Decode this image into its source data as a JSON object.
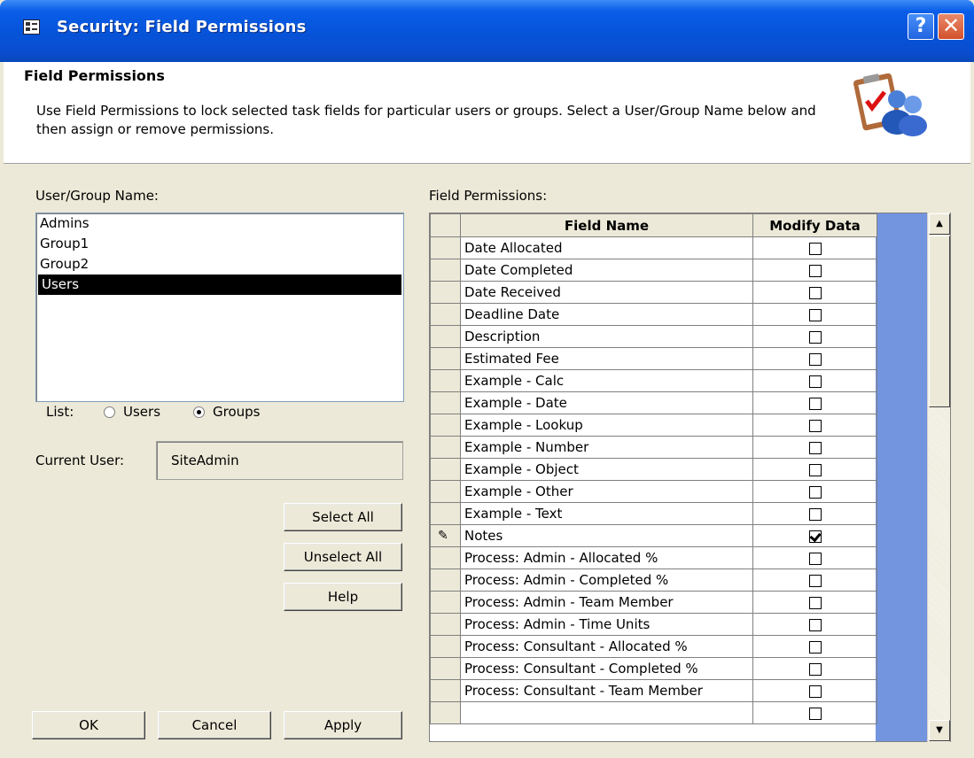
{
  "window": {
    "title": "Security: Field Permissions",
    "help_glyph": "?",
    "close_glyph": "✕"
  },
  "header": {
    "title": "Field Permissions",
    "description": "Use Field Permissions to lock selected task fields for particular users or groups. Select a User/Group Name below and then assign or remove permissions.",
    "icon": "clipboard-users-icon"
  },
  "left": {
    "user_group_label": "User/Group Name:",
    "items": [
      "Admins",
      "Group1",
      "Group2",
      "Users"
    ],
    "selected": "Users",
    "list_label": "List:",
    "radio_users": "Users",
    "radio_groups": "Groups",
    "radio_selected": "Groups",
    "current_user_label": "Current User:",
    "current_user_value": "SiteAdmin",
    "select_all": "Select All",
    "unselect_all": "Unselect All",
    "help": "Help"
  },
  "grid": {
    "label": "Field Permissions:",
    "col_field": "Field Name",
    "col_modify": "Modify Data",
    "rows": [
      {
        "name": "Date Allocated",
        "checked": false
      },
      {
        "name": "Date Completed",
        "checked": false
      },
      {
        "name": "Date Received",
        "checked": false
      },
      {
        "name": "Deadline Date",
        "checked": false
      },
      {
        "name": "Description",
        "checked": false
      },
      {
        "name": "Estimated Fee",
        "checked": false
      },
      {
        "name": "Example - Calc",
        "checked": false
      },
      {
        "name": "Example - Date",
        "checked": false
      },
      {
        "name": "Example - Lookup",
        "checked": false
      },
      {
        "name": "Example - Number",
        "checked": false
      },
      {
        "name": "Example - Object",
        "checked": false
      },
      {
        "name": "Example - Other",
        "checked": false
      },
      {
        "name": "Example - Text",
        "checked": false
      },
      {
        "name": "Notes",
        "checked": true,
        "editing": true
      },
      {
        "name": "Process:  Admin - Allocated %",
        "checked": false
      },
      {
        "name": "Process:  Admin - Completed %",
        "checked": false
      },
      {
        "name": "Process:  Admin - Team Member",
        "checked": false
      },
      {
        "name": "Process:  Admin - Time Units",
        "checked": false
      },
      {
        "name": "Process:  Consultant - Allocated %",
        "checked": false
      },
      {
        "name": "Process:  Consultant - Completed %",
        "checked": false
      },
      {
        "name": "Process:  Consultant - Team Member",
        "checked": false
      },
      {
        "name": "",
        "checked": false
      }
    ]
  },
  "footer": {
    "ok": "OK",
    "cancel": "Cancel",
    "apply": "Apply"
  }
}
